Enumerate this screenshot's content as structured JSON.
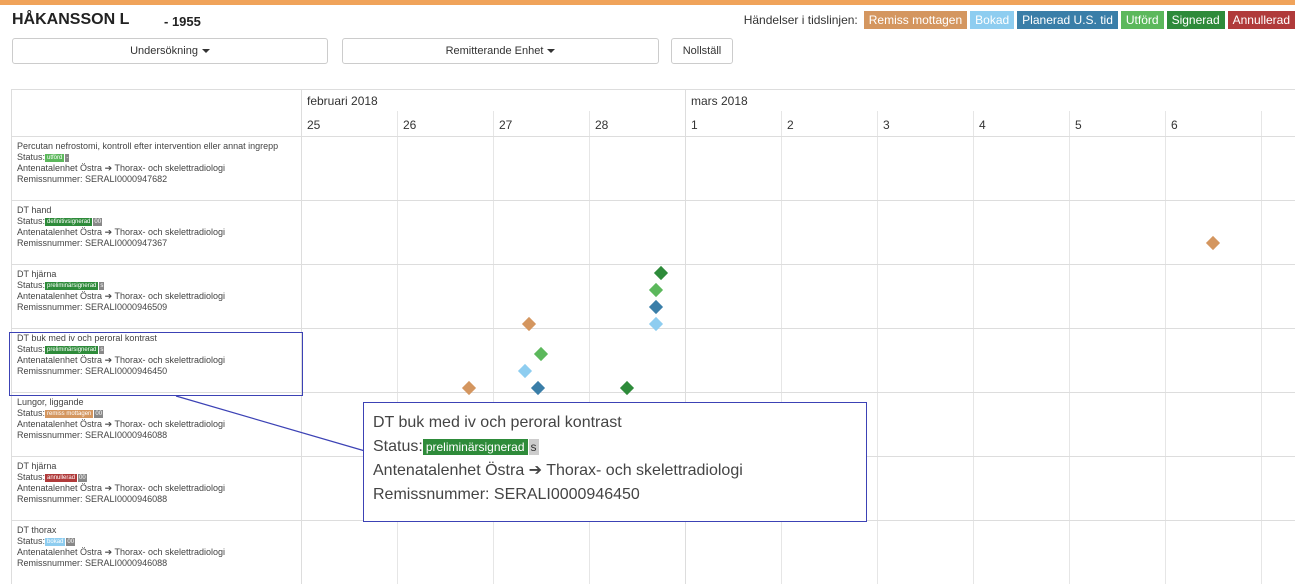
{
  "patient": {
    "name": "HÅKANSSON L",
    "year": "- 1955"
  },
  "legend": {
    "label": "Händelser i tidslinjen:",
    "items": [
      {
        "key": "remiss",
        "label": "Remiss mottagen",
        "color": "#d4965f"
      },
      {
        "key": "bokad",
        "label": "Bokad",
        "color": "#8ecdf0"
      },
      {
        "key": "planerad",
        "label": "Planerad U.S. tid",
        "color": "#3a7ea8"
      },
      {
        "key": "utford",
        "label": "Utförd",
        "color": "#5cb85c"
      },
      {
        "key": "signerad",
        "label": "Signerad",
        "color": "#2e8b3a"
      },
      {
        "key": "annullerad",
        "label": "Annullerad",
        "color": "#b03a3a"
      }
    ]
  },
  "filters": {
    "undersokning_label": "Undersökning",
    "remitterande_label": "Remitterande Enhet",
    "reset_label": "Nollställ"
  },
  "timeline": {
    "months": [
      {
        "label": "februari 2018"
      },
      {
        "label": "mars 2018"
      }
    ],
    "days": [
      "25",
      "26",
      "27",
      "28",
      "1",
      "2",
      "3",
      "4",
      "5",
      "6"
    ]
  },
  "rows": [
    {
      "title": "Percutan nefrostomi, kontroll efter intervention eller annat ingrepp",
      "status_label": "Status:",
      "status": "utförd",
      "status_color": "#5cb85c",
      "code": "-",
      "route_from": "Antenatalenhet Östra",
      "route_to": "Thorax- och skelettradiologi",
      "remiss_label": "Remissnummer:",
      "remiss_number": "SERALI0000947682",
      "events": []
    },
    {
      "title": "DT hand",
      "status_label": "Status:",
      "status": "definitivsignerad",
      "status_color": "#2e8b3a",
      "code": "00",
      "route_from": "Antenatalenhet Östra",
      "route_to": "Thorax- och skelettradiologi",
      "remiss_label": "Remissnummer:",
      "remiss_number": "SERALI0000947367",
      "events": [
        {
          "type": "remiss",
          "day": 6.5,
          "slot": 2
        }
      ]
    },
    {
      "title": "DT hjärna",
      "status_label": "Status:",
      "status": "preliminärsignerad",
      "status_color": "#2e8b3a",
      "code": "s",
      "route_from": "Antenatalenhet Östra",
      "route_to": "Thorax- och skelettradiologi",
      "remiss_label": "Remissnummer:",
      "remiss_number": "SERALI0000946509",
      "events": [
        {
          "type": "signerad",
          "day": 28.75,
          "slot": 0
        },
        {
          "type": "utford",
          "day": 28.7,
          "slot": 1
        },
        {
          "type": "planerad",
          "day": 28.7,
          "slot": 2
        },
        {
          "type": "bokad",
          "day": 28.7,
          "slot": 3
        },
        {
          "type": "remiss",
          "day": 27.37,
          "slot": 3
        }
      ]
    },
    {
      "title": "DT buk med iv och peroral kontrast",
      "status_label": "Status:",
      "status": "preliminärsignerad",
      "status_color": "#2e8b3a",
      "code": "s",
      "route_from": "Antenatalenhet Östra",
      "route_to": "Thorax- och skelettradiologi",
      "remiss_label": "Remissnummer:",
      "remiss_number": "SERALI0000946450",
      "events": [
        {
          "type": "utford",
          "day": 27.5,
          "slot": 1
        },
        {
          "type": "bokad",
          "day": 27.33,
          "slot": 2
        },
        {
          "type": "planerad",
          "day": 27.47,
          "slot": 3
        },
        {
          "type": "remiss",
          "day": 26.75,
          "slot": 3
        },
        {
          "type": "signerad",
          "day": 28.4,
          "slot": 3
        }
      ]
    },
    {
      "title": "Lungor, liggande",
      "status_label": "Status:",
      "status": "remiss mottagen",
      "status_color": "#d4965f",
      "code": "00",
      "route_from": "Antenatalenhet Östra",
      "route_to": "Thorax- och skelettradiologi",
      "remiss_label": "Remissnummer:",
      "remiss_number": "SERALI0000946088",
      "events": []
    },
    {
      "title": "DT hjärna",
      "status_label": "Status:",
      "status": "annullerad",
      "status_color": "#b03a3a",
      "code": "00",
      "route_from": "Antenatalenhet Östra",
      "route_to": "Thorax- och skelettradiologi",
      "remiss_label": "Remissnummer:",
      "remiss_number": "SERALI0000946088",
      "events": []
    },
    {
      "title": "DT thorax",
      "status_label": "Status:",
      "status": "bokad",
      "status_color": "#8ecdf0",
      "code": "00",
      "route_from": "Antenatalenhet Östra",
      "route_to": "Thorax- och skelettradiologi",
      "remiss_label": "Remissnummer:",
      "remiss_number": "SERALI0000946088",
      "events": []
    }
  ],
  "callout": {
    "title": "DT buk med iv och peroral kontrast",
    "status_label": "Status:",
    "status": "preliminärsignerad",
    "code": "s",
    "route_from": "Antenatalenhet Östra",
    "route_to": "Thorax- och skelettradiologi",
    "remiss_label": "Remissnummer:",
    "remiss_number": "SERALI0000946450"
  }
}
